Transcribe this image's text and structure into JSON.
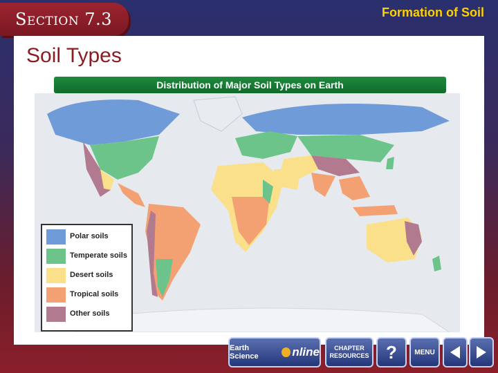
{
  "header": {
    "section": "Section 7.3",
    "chapter_title": "Formation of Soil"
  },
  "page": {
    "title": "Soil Types"
  },
  "figure": {
    "title": "Distribution of Major Soil Types on Earth",
    "legend": [
      {
        "label": "Polar soils",
        "color": "#6f9bd8"
      },
      {
        "label": "Temperate soils",
        "color": "#6cc48a"
      },
      {
        "label": "Desert soils",
        "color": "#fbe08c"
      },
      {
        "label": "Tropical soils",
        "color": "#f3a072"
      },
      {
        "label": "Other soils",
        "color": "#b27a8e"
      }
    ]
  },
  "nav": {
    "esonline_brand": "Earth Science",
    "esonline_online": "nline",
    "chapter_resources": "CHAPTER RESOURCES",
    "help": "?",
    "menu": "MENU",
    "prev_icon": "triangle-left-icon",
    "next_icon": "triangle-right-icon"
  }
}
